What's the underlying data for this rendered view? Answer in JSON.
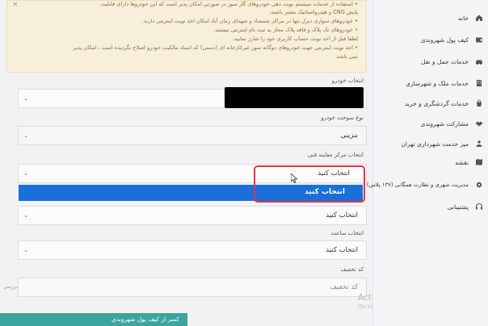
{
  "notice": {
    "close": "×",
    "lines": [
      "• استفاده از خدمات سیستم نوبت دهی خودروهای گاز سوز در صورتی امکان پذیر است که این خودروها دارای قابلیت",
      "پایش CNG و هیدرواستاتیک معتبر باشند.",
      "• خودروهای سواری دیزل تنها در مراکز شمشاد و شهدای زمان آباد امکان اخذ نوبت اینترنتی دارند.",
      "• خودروهای تک پلاک و فاقد پلاک مجاز به ثبت نام اینترنتی نیستند.",
      "لطفا قبل از اخذ نوبت حساب کاربری خود را شارژ نمایید.",
      "• اخذ نوبت اینترنتی جهت خودروهای دوگانه سوز غیرکارخانه ای (دستی) که اسناد مالکیت خودرو اصلاح نگردیده است ، امکان پذیر",
      "نمی باشد."
    ]
  },
  "form": {
    "vehicle_label": "انتخاب خودرو",
    "fuel_label": "نوع سوخت خودرو",
    "fuel_value": "بنزینی",
    "center_label": "انتخاب مرکز معاینه فنی",
    "center_value": "انتخاب کنید",
    "dropdown_option": "انتخاب کنید",
    "date_value": "انتخاب کنید",
    "time_label": "انتخاب ساعت",
    "time_value": "انتخاب کنید",
    "discount_label": "کد تخفیف",
    "discount_placeholder": "کد تخفیف",
    "discount_check": "بررسی",
    "wallet_button": "کسر از کیف پول شهروندی"
  },
  "sidebar": {
    "items": [
      {
        "label": "خانه",
        "icon": "home-icon"
      },
      {
        "label": "کیف پول شهروندی",
        "icon": "wallet-icon"
      },
      {
        "label": "خدمات حمل و نقل",
        "icon": "car-icon"
      },
      {
        "label": "خدمات ملک و شهرسازی",
        "icon": "building-icon"
      },
      {
        "label": "خدمات گردشگری و خرید",
        "icon": "shopping-icon"
      },
      {
        "label": "مشارکت شهروندی",
        "icon": "handshake-icon"
      },
      {
        "label": "میز خدمت شهرداری تهران",
        "icon": "desk-icon"
      },
      {
        "label": "نقشه",
        "icon": "map-icon"
      },
      {
        "label": "مدیریت شهری و نظارت همگانی (۱۳۷ پلاس)",
        "icon": "settings-icon"
      },
      {
        "label": "پشتیبانی",
        "icon": "support-icon"
      }
    ]
  },
  "watermark": {
    "title": "Activate Windows",
    "subtitle": "Go to Settings to activate Windows."
  },
  "colors": {
    "accent": "#1a6fd9",
    "highlight": "#e0364a",
    "teal": "#3aa59d"
  }
}
